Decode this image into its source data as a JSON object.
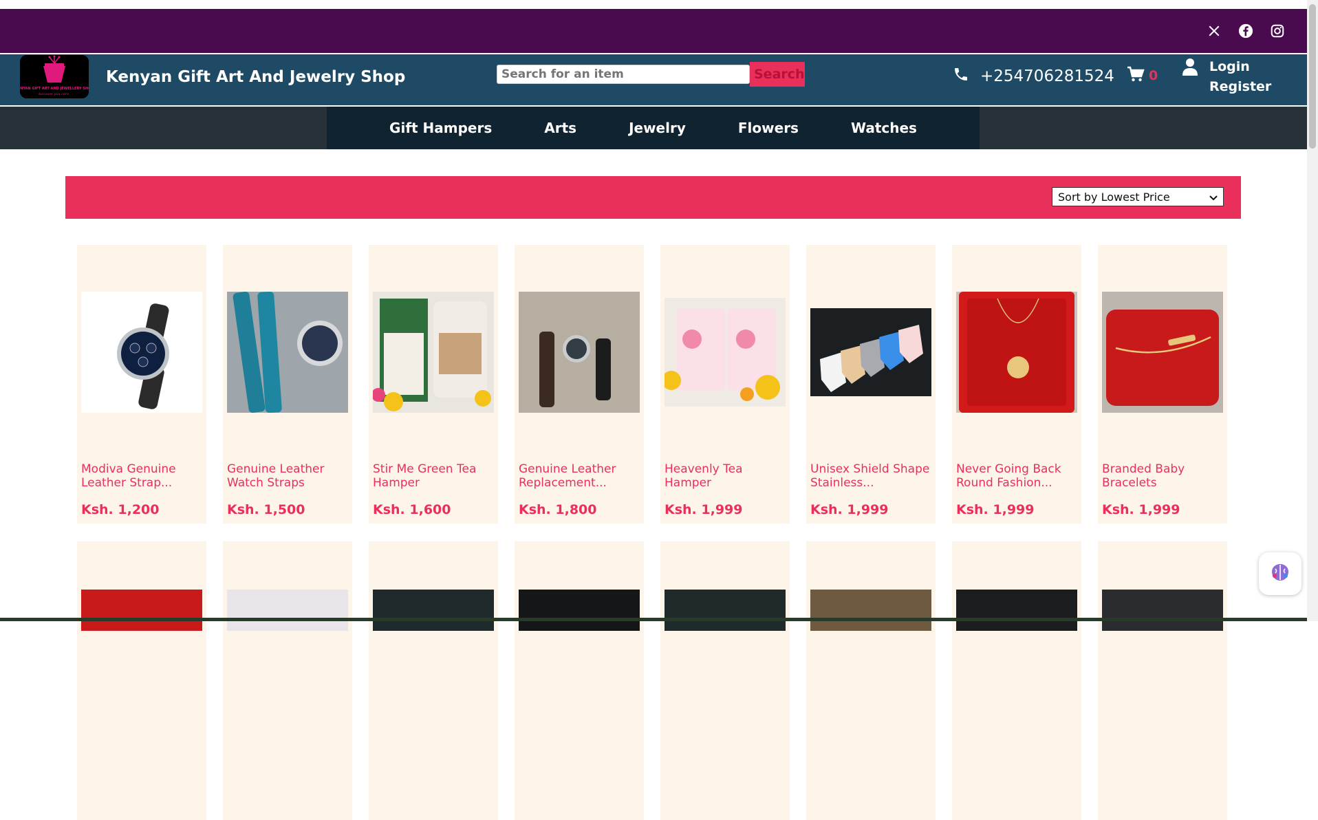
{
  "social": {
    "icons": [
      "x-icon",
      "facebook-icon",
      "instagram-icon"
    ]
  },
  "header": {
    "title": "Kenyan Gift Art And Jewelry Shop",
    "logo_text": "KENYAN GIFT ART AND JEWELLERY SHOP",
    "logo_tagline": "because you care.",
    "search_placeholder": "Search for an item",
    "search_button": "Search",
    "phone": "+254706281524",
    "cart_count": "0",
    "login": "Login",
    "register": "Register"
  },
  "nav": {
    "items": [
      "Gift Hampers",
      "Arts",
      "Jewelry",
      "Flowers",
      "Watches"
    ]
  },
  "sort": {
    "selected": "Sort by Lowest Price"
  },
  "products": [
    {
      "name": "Modiva Genuine Leather Strap...",
      "price": "Ksh. 1,200"
    },
    {
      "name": "Genuine Leather Watch Straps",
      "price": "Ksh. 1,500"
    },
    {
      "name": "Stir Me Green Tea Hamper",
      "price": "Ksh. 1,600"
    },
    {
      "name": "Genuine Leather Replacement...",
      "price": "Ksh. 1,800"
    },
    {
      "name": "Heavenly Tea Hamper",
      "price": "Ksh. 1,999"
    },
    {
      "name": "Unisex Shield Shape Stainless...",
      "price": "Ksh. 1,999"
    },
    {
      "name": "Never Going Back Round Fashion...",
      "price": "Ksh. 1,999"
    },
    {
      "name": "Branded Baby Bracelets",
      "price": "Ksh. 1,999"
    }
  ],
  "colors": {
    "topbar": "#4a0a4f",
    "header": "#1f4a66",
    "accent": "#e8305a",
    "card_bg": "#fdf4ea"
  }
}
